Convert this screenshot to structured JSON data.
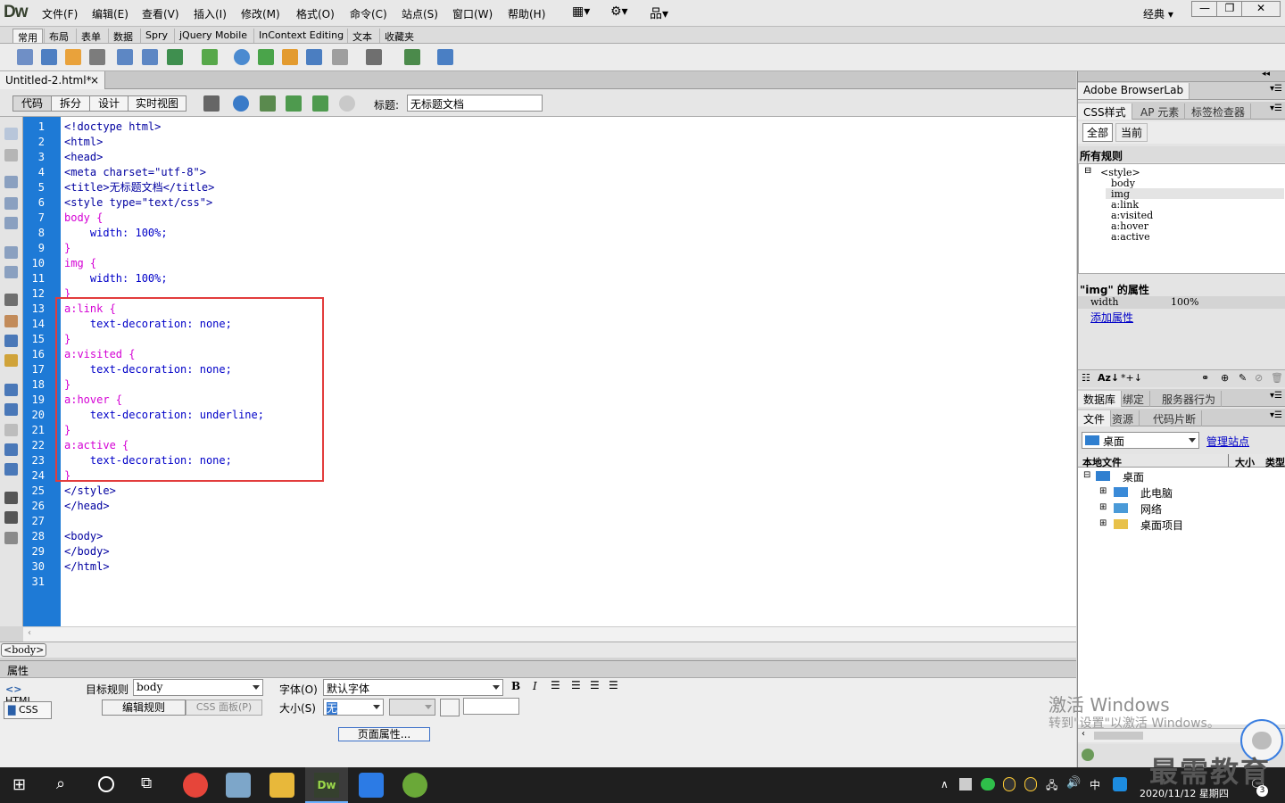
{
  "app": {
    "logo": "Dw",
    "workspace": "经典"
  },
  "menu": [
    "文件(F)",
    "编辑(E)",
    "查看(V)",
    "插入(I)",
    "修改(M)",
    "格式(O)",
    "命令(C)",
    "站点(S)",
    "窗口(W)",
    "帮助(H)"
  ],
  "insert_tabs": [
    "常用",
    "布局",
    "表单",
    "数据",
    "Spry",
    "jQuery Mobile",
    "InContext Editing",
    "文本",
    "收藏夹"
  ],
  "doc": {
    "tab": "Untitled-2.html*",
    "close": "×",
    "views": [
      "代码",
      "拆分",
      "设计",
      "实时视图"
    ],
    "title_label": "标题:",
    "title_value": "无标题文档"
  },
  "code_lines": [
    "<!doctype html>",
    "<html>",
    "<head>",
    "<meta charset=\"utf-8\">",
    "<title>无标题文档</title>",
    "<style type=\"text/css\">",
    "body {",
    "    width: 100%;",
    "}",
    "img {",
    "    width: 100%;",
    "}",
    "a:link {",
    "    text-decoration: none;",
    "}",
    "a:visited {",
    "    text-decoration: none;",
    "}",
    "a:hover {",
    "    text-decoration: underline;",
    "}",
    "a:active {",
    "    text-decoration: none;",
    "}",
    "</style>",
    "</head>",
    "",
    "<body>",
    "</body>",
    "</html>",
    ""
  ],
  "tag_selector": "<body>",
  "properties": {
    "header": "属性",
    "html_btn": "HTML",
    "css_btn": "CSS",
    "target_rule_label": "目标规则",
    "target_rule_value": "body",
    "edit_rule": "编辑规则",
    "css_panel": "CSS 面板(P)",
    "font_label": "字体(O)",
    "font_value": "默认字体",
    "size_label": "大小(S)",
    "size_value": "无",
    "page_props": "页面属性..."
  },
  "right": {
    "browserlab": "Adobe BrowserLab",
    "css_tabs": [
      "CSS样式",
      "AP 元素",
      "标签检查器"
    ],
    "mode_all": "全部",
    "mode_current": "当前",
    "all_rules": "所有规则",
    "rules": [
      "<style>",
      "body",
      "img",
      "a:link",
      "a:visited",
      "a:hover",
      "a:active"
    ],
    "props_title": "\"img\" 的属性",
    "prop_name": "width",
    "prop_value": "100%",
    "add_prop": "添加属性",
    "db_tabs": [
      "数据库",
      "绑定",
      "服务器行为"
    ],
    "file_tabs": [
      "文件",
      "资源",
      "代码片断"
    ],
    "location": "桌面",
    "manage_site": "管理站点",
    "col_local": "本地文件",
    "col_size": "大小",
    "col_type": "类型",
    "files": [
      "桌面",
      "此电脑",
      "网络",
      "桌面项目"
    ]
  },
  "watermark": {
    "line1": "激活 Windows",
    "line2": "转到\"设置\"以激活 Windows。"
  },
  "brand": "最需教育",
  "taskbar": {
    "ime": "中",
    "datetime": "2020/11/12 星期四",
    "badge": "3"
  }
}
